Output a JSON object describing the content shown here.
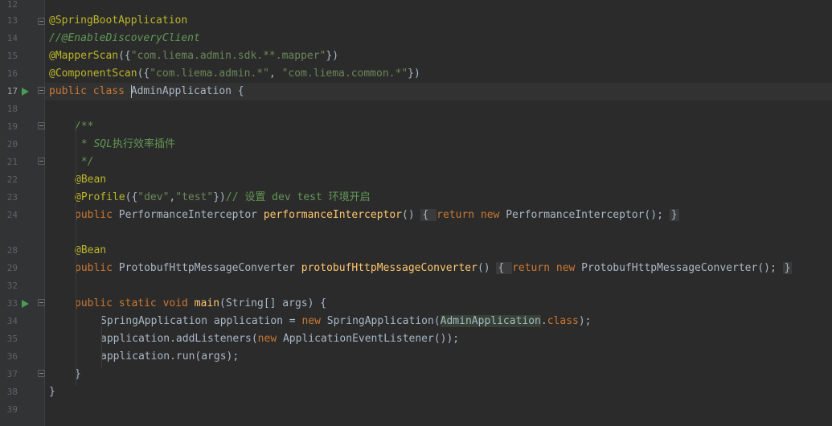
{
  "editor": {
    "line_numbers": [
      "12",
      "13",
      "14",
      "15",
      "16",
      "17",
      "18",
      "19",
      "20",
      "21",
      "22",
      "23",
      "24",
      "28",
      "29",
      "32",
      "33",
      "34",
      "35",
      "36",
      "37",
      "38",
      "39"
    ],
    "active_line": "17",
    "run_lines": [
      "17",
      "33"
    ],
    "lines": {
      "l13": "@SpringBootApplication",
      "l14": "//@EnableDiscoveryClient",
      "l15_a": "@MapperScan",
      "l15_b": "({",
      "l15_c": "\"com.liema.admin.sdk.**.mapper\"",
      "l15_d": "})",
      "l16_a": "@ComponentScan",
      "l16_b": "({",
      "l16_c": "\"com.liema.admin.*\"",
      "l16_d": ", ",
      "l16_e": "\"com.liema.common.*\"",
      "l16_f": "})",
      "l17_a": "public class ",
      "l17_b": "AdminApplication",
      "l17_c": " {",
      "l19": "/**",
      "l20_a": " * ",
      "l20_b": "SQL",
      "l20_c": "执行效率插件",
      "l21": " */",
      "l22": "@Bean",
      "l23_a": "@Profile",
      "l23_b": "({",
      "l23_c": "\"dev\"",
      "l23_d": ",",
      "l23_e": "\"test\"",
      "l23_f": "})",
      "l23_g": "// 设置 dev test 环境开启",
      "l24_a": "public ",
      "l24_b": "PerformanceInterceptor ",
      "l24_c": "performanceInterceptor",
      "l24_d": "() ",
      "l24_e": "{ ",
      "l24_f": "return new ",
      "l24_g": "PerformanceInterceptor(); ",
      "l24_h": "}",
      "l28": "@Bean",
      "l29_a": "public ",
      "l29_b": "ProtobufHttpMessageConverter ",
      "l29_c": "protobufHttpMessageConverter",
      "l29_d": "() ",
      "l29_e": "{ ",
      "l29_f": "return new ",
      "l29_g": "ProtobufHttpMessageConverter(); ",
      "l29_h": "}",
      "l33_a": "public static void ",
      "l33_b": "main",
      "l33_c": "(String[] args) {",
      "l34_a": "SpringApplication application = ",
      "l34_b": "new ",
      "l34_c": "SpringApplication(",
      "l34_d": "AdminApplication",
      "l34_e": ".",
      "l34_f": "class",
      "l34_g": ");",
      "l35_a": "application.addListeners(",
      "l35_b": "new ",
      "l35_c": "ApplicationEventListener());",
      "l36": "application.run(args);",
      "l37": "}",
      "l38": "}"
    }
  },
  "colors": {
    "background": "#2b2b2b",
    "gutter": "#313335",
    "annotation": "#bbb529",
    "keyword": "#cc7832",
    "string": "#6a8759",
    "method": "#ffc66d",
    "comment": "#629755",
    "run_icon": "#499c54"
  },
  "icons": [
    "run-gutter-icon",
    "fold-icon"
  ]
}
